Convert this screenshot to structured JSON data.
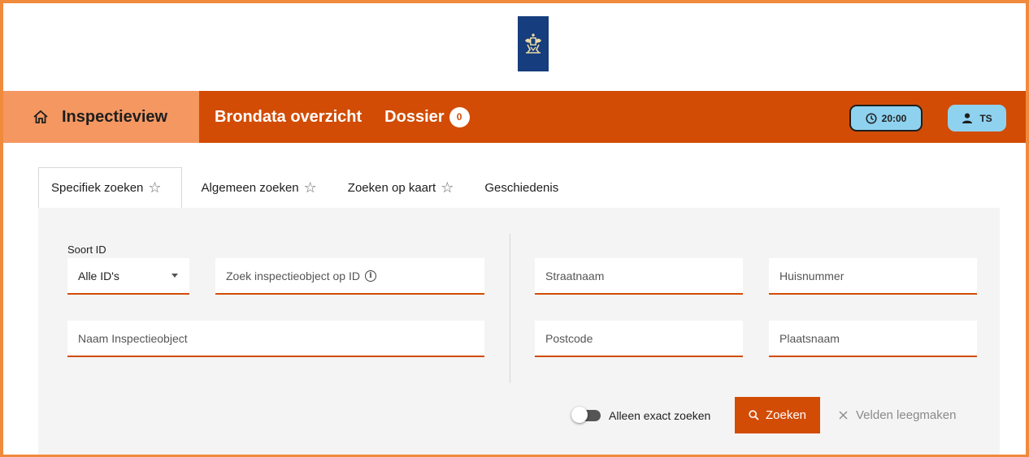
{
  "colors": {
    "brand_orange": "#d24c05",
    "home_tab_bg": "#f49761",
    "logo_blue": "#163d7d",
    "pill_blue": "#8fd2ef",
    "frame": "#f08a3c"
  },
  "nav": {
    "home_icon": "home-icon",
    "title": "Inspectieview",
    "brondata": "Brondata overzicht",
    "dossier": "Dossier",
    "dossier_count": "0",
    "timer": "20:00",
    "timer_icon": "clock-icon",
    "user_icon": "user-icon",
    "user_initials": "TS"
  },
  "tabs": [
    {
      "label": "Specifiek zoeken",
      "star": "☆",
      "active": true
    },
    {
      "label": "Algemeen zoeken",
      "star": "☆"
    },
    {
      "label": "Zoeken op kaart",
      "star": "☆"
    },
    {
      "label": "Geschiedenis"
    }
  ],
  "form": {
    "soort_label": "Soort ID",
    "soort_value": "Alle ID's",
    "id_placeholder": "Zoek inspectieobject op ID",
    "naam_placeholder": "Naam Inspectieobject",
    "straat_placeholder": "Straatnaam",
    "huisnummer_placeholder": "Huisnummer",
    "postcode_placeholder": "Postcode",
    "plaats_placeholder": "Plaatsnaam",
    "exact_label": "Alleen exact zoeken",
    "exact_on": false,
    "search_label": "Zoeken",
    "clear_label": "Velden leegmaken"
  }
}
